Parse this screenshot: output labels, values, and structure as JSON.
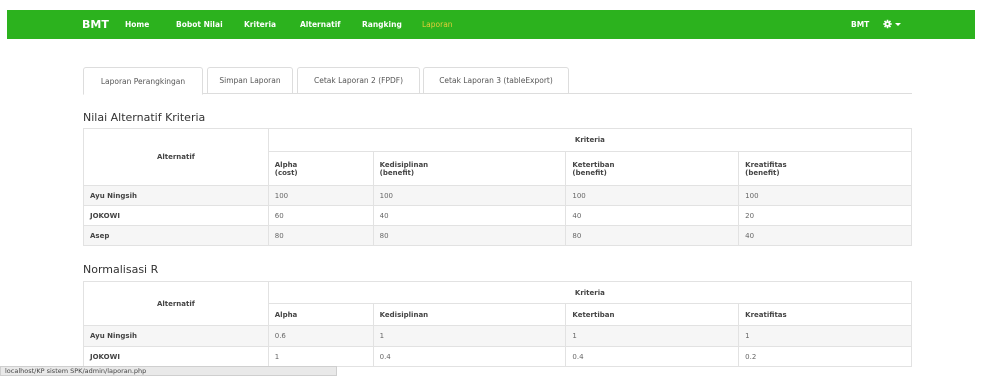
{
  "navbar": {
    "brand": "BMT",
    "items": [
      {
        "label": "Home"
      },
      {
        "label": "Bobot Nilai"
      },
      {
        "label": "Kriteria"
      },
      {
        "label": "Alternatif"
      },
      {
        "label": "Rangking"
      },
      {
        "label": "Laporan",
        "active": true
      }
    ],
    "user": "BMT",
    "settings_icon": "gear-icon",
    "active_color": "#e3cd39",
    "bg_color": "#2cb21e"
  },
  "tabs": [
    {
      "label": "Laporan Perangkingan",
      "active": true
    },
    {
      "label": "Simpan Laporan"
    },
    {
      "label": "Cetak Laporan 2 (FPDF)"
    },
    {
      "label": "Cetak Laporan 3 (tableExport)"
    }
  ],
  "table1": {
    "title": "Nilai Alternatif Kriteria",
    "alt_header": "Alternatif",
    "group_header": "Kriteria",
    "columns": [
      {
        "name": "Alpha",
        "type": "(cost)"
      },
      {
        "name": "Kedisiplinan",
        "type": "(benefit)"
      },
      {
        "name": "Ketertiban",
        "type": "(benefit)"
      },
      {
        "name": "Kreatifitas",
        "type": "(benefit)"
      }
    ],
    "rows": [
      {
        "name": "Ayu Ningsih",
        "values": [
          "100",
          "100",
          "100",
          "100"
        ]
      },
      {
        "name": "JOKOWI",
        "values": [
          "60",
          "40",
          "40",
          "20"
        ]
      },
      {
        "name": "Asep",
        "values": [
          "80",
          "80",
          "80",
          "40"
        ]
      }
    ]
  },
  "table2": {
    "title": "Normalisasi R",
    "alt_header": "Alternatif",
    "group_header": "Kriteria",
    "columns": [
      "Alpha",
      "Kedisiplinan",
      "Ketertiban",
      "Kreatifitas"
    ],
    "rows": [
      {
        "name": "Ayu Ningsih",
        "values": [
          "0.6",
          "1",
          "1",
          "1"
        ]
      },
      {
        "name": "JOKOWI",
        "values": [
          "1",
          "0.4",
          "0.4",
          "0.2"
        ]
      }
    ]
  },
  "status_url": "localhost/KP sistem SPK/admin/laporan.php"
}
